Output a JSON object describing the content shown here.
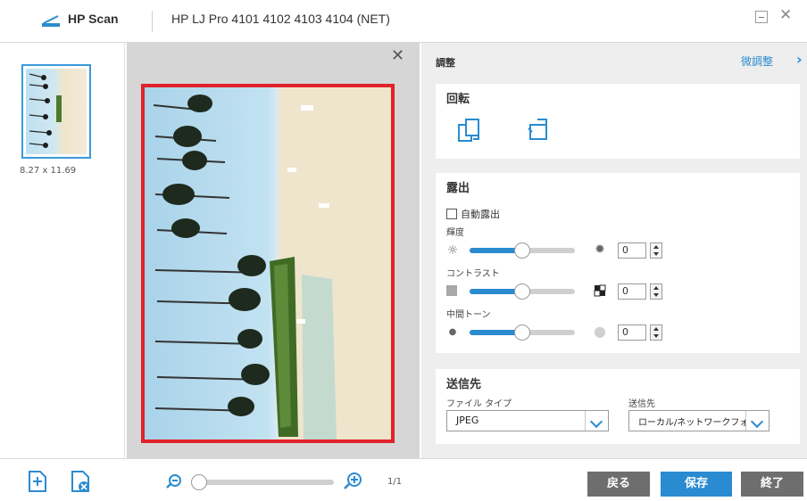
{
  "titlebar": {
    "app_name": "HP Scan",
    "device": "HP LJ Pro 4101 4102 4103 4104 (NET)",
    "minimize_icon": "minimize-icon",
    "close_icon": "close-icon"
  },
  "thumbnails": {
    "size_label": "8.27 x 11.69"
  },
  "adjust": {
    "title": "調整",
    "fine_tune_label": "微調整",
    "chevron_icon": "chevron-right-icon"
  },
  "rotate": {
    "title": "回転",
    "left_icon": "rotate-left-icon",
    "right_icon": "rotate-right-icon"
  },
  "exposure": {
    "title": "露出",
    "auto_label": "自動露出",
    "auto_checked": false,
    "brightness": {
      "label": "輝度",
      "value": "0",
      "level": 0.5
    },
    "contrast": {
      "label": "コントラスト",
      "value": "0",
      "level": 0.5
    },
    "midtone": {
      "label": "中間トーン",
      "value": "0",
      "level": 0.5
    }
  },
  "destination": {
    "title": "送信先",
    "file_type_label": "ファイル タイプ",
    "file_type_value": "JPEG",
    "dest_label": "送信先",
    "dest_value": "ローカル/ネットワークフォルダ"
  },
  "bottom": {
    "page_indicator": "1/1",
    "back_label": "戻る",
    "save_label": "保存",
    "end_label": "終了"
  },
  "colors": {
    "accent": "#2b8bd0",
    "frame": "#e0222a",
    "gray_button": "#6e6e6e"
  }
}
